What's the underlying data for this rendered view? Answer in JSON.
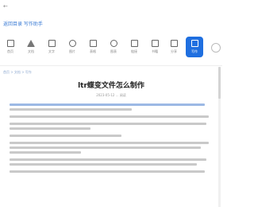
{
  "header": {
    "back_icon": "arrow-left-icon",
    "link_text": "返回目录 写作助手",
    "link_color": "#3a7bd5"
  },
  "toolbar": {
    "accent": "#1f6fe0",
    "items": [
      {
        "icon": "home-icon",
        "label": "首页"
      },
      {
        "icon": "file-icon",
        "label": "文档"
      },
      {
        "icon": "text-icon",
        "label": "文字"
      },
      {
        "icon": "image-icon",
        "label": "图片"
      },
      {
        "icon": "table-icon",
        "label": "表格"
      },
      {
        "icon": "chart-icon",
        "label": "图表"
      },
      {
        "icon": "link-icon",
        "label": "链接"
      },
      {
        "icon": "book-icon",
        "label": "书籍"
      },
      {
        "icon": "share-icon",
        "label": "分享"
      },
      {
        "icon": "write-icon",
        "label": "写作"
      }
    ],
    "more_icon": "more-icon"
  },
  "breadcrumb": "首页 > 文档 > 写作",
  "article": {
    "title": "ltr蝶变文件怎么制作",
    "meta": "2023-05-12 ... 阅读"
  },
  "scroll_position": 0.0
}
